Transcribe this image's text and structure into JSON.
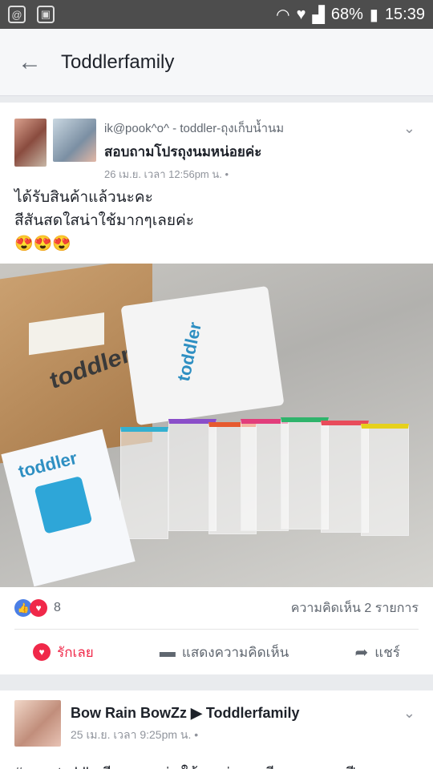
{
  "statusbar": {
    "icons_left": [
      "@",
      "🖼"
    ],
    "battery": "68%",
    "time": "15:39"
  },
  "header": {
    "back_icon": "arrow-left-icon",
    "title": "Toddlerfamily"
  },
  "post1": {
    "author_line": "ik@pook^o^ - toddler-ถุงเก็บน้ำนม",
    "subtitle": "สอบถามโปรถุงนมหน่อยค่ะ",
    "meta": "26 เม.ย. เวลา 12:56pm น. •",
    "body_line1": "ได้รับสินค้าแล้วนะคะ",
    "body_line2": "สีสันสดใสน่าใช้มากๆเลยค่ะ",
    "emojis": "😍😍😍",
    "photo_brand_box": "toddler",
    "photo_brand_stack": "toddler",
    "photo_brand_bag": "toddler",
    "reaction_count": "8",
    "comments_text": "ความคิดเห็น 2 รายการ",
    "actions": {
      "love_label": "รักเลย",
      "comment_label": "แสดงความคิดเห็น",
      "share_label": "แชร์"
    }
  },
  "post2": {
    "author_line": "Bow Rain BowZz ▶ Toddlerfamily",
    "meta": "25 เม.ย. เวลา 9:25pm น. •",
    "body": "#ถุงนมtoddlerดีมากเลยค่ะ ใช้งานง่าย เหนียว ทนทาน ปี"
  }
}
